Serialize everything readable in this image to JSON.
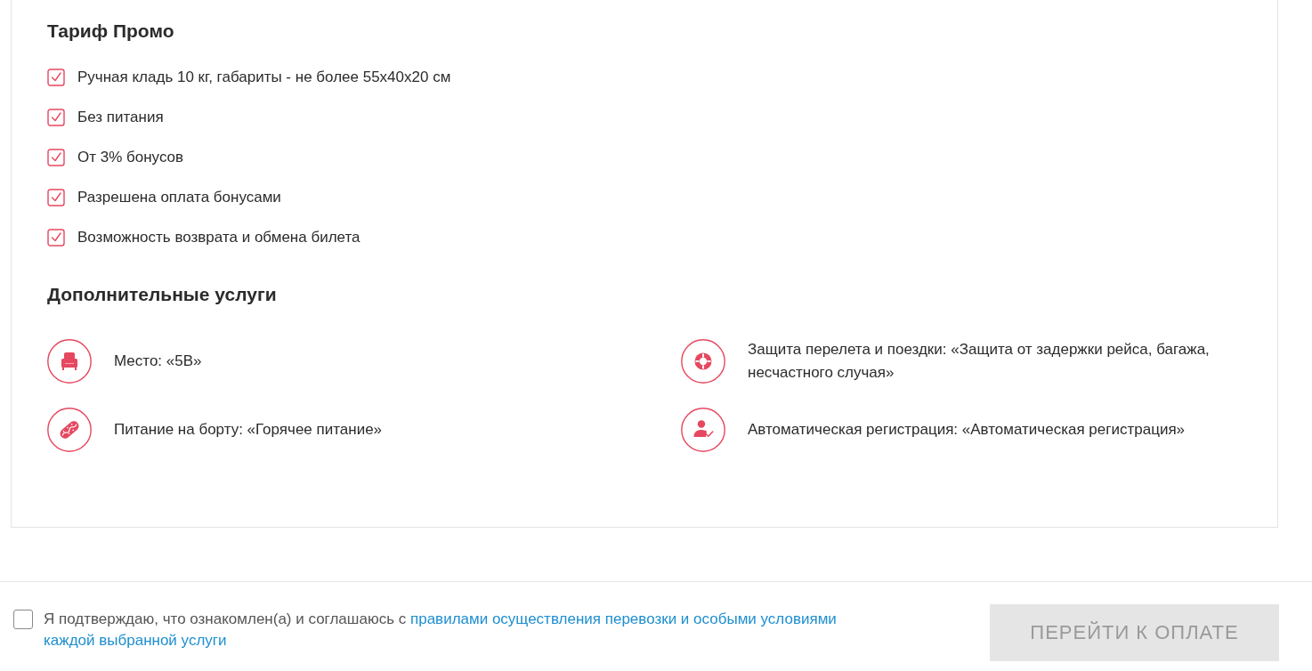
{
  "tariff": {
    "title": "Тариф Промо",
    "features": [
      {
        "text": "Ручная кладь 10 кг, габариты - не более 55x40x20 см",
        "checked": true
      },
      {
        "text": "Без питания",
        "checked": true
      },
      {
        "text": "От 3% бонусов",
        "checked": true
      },
      {
        "text": "Разрешена оплата бонусами",
        "checked": true
      },
      {
        "text": "Возможность возврата и обмена билета",
        "checked": true
      }
    ]
  },
  "extras": {
    "title": "Дополнительные услуги",
    "items": [
      {
        "kind": "seat",
        "text": "Место: «5B»"
      },
      {
        "kind": "meal",
        "text": "Питание на борту: «Горячее питание»"
      },
      {
        "kind": "insurance",
        "text": "Защита перелета и поездки: «Защита от задержки рейса, багажа, несчастного случая»"
      },
      {
        "kind": "checkin",
        "text": "Автоматическая регистрация: «Автоматическая регистрация»"
      }
    ]
  },
  "footer": {
    "agreement": {
      "checked": false,
      "text": "Я подтверждаю, что ознакомлен(а) и соглашаюсь с",
      "links": [
        "правилами осуществления перевозки и особыми условиями",
        "каждой выбранной услуги"
      ]
    },
    "pay_button": {
      "label": "ПЕРЕЙТИ К ОПЛАТЕ",
      "disabled": true
    }
  }
}
